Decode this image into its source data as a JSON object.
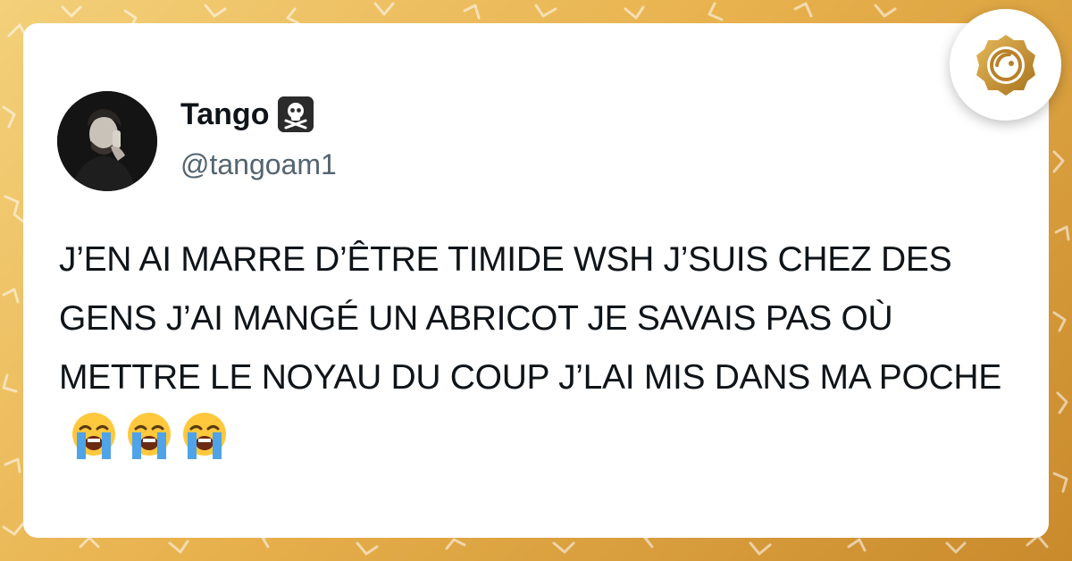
{
  "tweet": {
    "author": {
      "display_name": "Tango",
      "name_emoji": "skull-crossbones-icon",
      "handle": "@tangoam1"
    },
    "text": "J’EN AI MARRE D’ÊTRE TIMIDE WSH J’SUIS CHEZ DES GENS J’AI MANGÉ UN ABRICOT JE SAVAIS PAS OÙ METTRE LE NOYAU DU COUP J’LAI MIS DANS MA POCHE",
    "trailing_emojis": [
      "loudly-crying-face-icon",
      "loudly-crying-face-icon",
      "loudly-crying-face-icon"
    ]
  },
  "brand": {
    "logo_icon": "golden-seal-logo-icon",
    "accent_color": "#c98a2c",
    "background_color": "#e8b24e"
  }
}
